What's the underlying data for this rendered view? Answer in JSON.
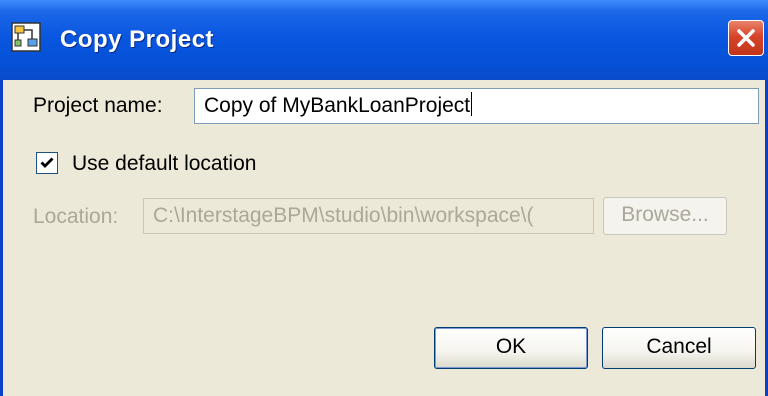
{
  "window": {
    "title": "Copy Project"
  },
  "form": {
    "project_name_label": "Project name:",
    "project_name_value": "Copy of MyBankLoanProject",
    "use_default_location_label": "Use default location",
    "use_default_location_checked": true,
    "location_label": "Location:",
    "location_value": "C:\\InterstageBPM\\studio\\bin\\workspace\\(",
    "browse_label": "Browse..."
  },
  "buttons": {
    "ok_label": "OK",
    "cancel_label": "Cancel"
  },
  "icons": {
    "title_icon": "project-icon",
    "close_icon": "close-icon",
    "checkbox_icon": "checkmark-icon"
  },
  "colors": {
    "titlebar": "#0552d8",
    "close_button": "#d6452a",
    "dialog_background": "#ece9d8"
  }
}
